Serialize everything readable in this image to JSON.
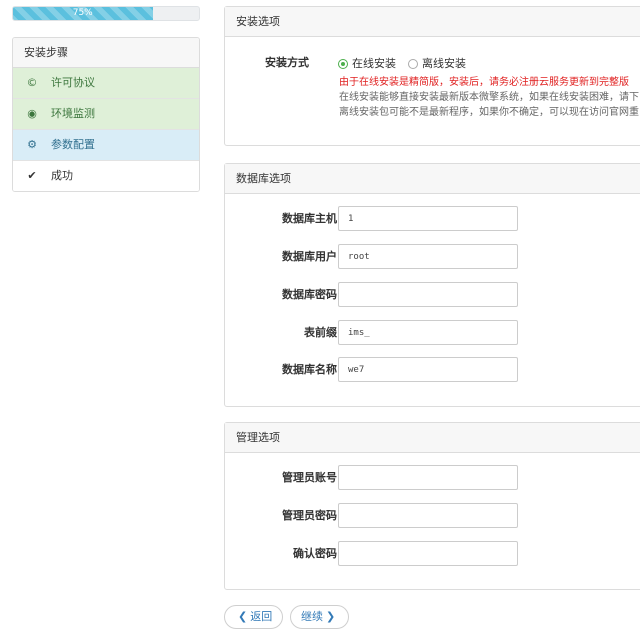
{
  "progress": {
    "value": 0.75,
    "label": "75%"
  },
  "steps": {
    "title": "安装步骤",
    "items": [
      {
        "label": "许可协议",
        "icon": "copyright-icon",
        "glyph": "©",
        "state": "done"
      },
      {
        "label": "环境监测",
        "icon": "eye-icon",
        "glyph": "◉",
        "state": "done"
      },
      {
        "label": "参数配置",
        "icon": "gear-icon",
        "glyph": "⚙",
        "state": "active"
      },
      {
        "label": "成功",
        "icon": "check-icon",
        "glyph": "✔",
        "state": "todo"
      }
    ]
  },
  "install": {
    "title": "安装选项",
    "method_label": "安装方式",
    "online_label": "在线安装",
    "offline_label": "离线安装",
    "selected": "在线安装",
    "note_red": "由于在线安装是精简版，安装后，请务必注册云服务更新到完整版",
    "note_line1": "在线安装能够直接安装最新版本微擎系统，如果在线安装困难，请下",
    "note_line2": "离线安装包可能不是最新程序，如果你不确定，可以现在访问官网重"
  },
  "database": {
    "title": "数据库选项",
    "host_label": "数据库主机",
    "host_value": "1",
    "user_label": "数据库用户",
    "user_value": "root",
    "password_label": "数据库密码",
    "password_value": "",
    "prefix_label": "表前缀",
    "prefix_value": "ims_",
    "name_label": "数据库名称",
    "name_value": "we7"
  },
  "admin": {
    "title": "管理选项",
    "account_label": "管理员账号",
    "password_label": "管理员密码",
    "confirm_label": "确认密码"
  },
  "buttons": {
    "back_label": "返回",
    "next_label": "继续"
  },
  "colors": {
    "done_bg": "#dff0d8",
    "active_bg": "#d9edf7",
    "progress": "#5bc0de",
    "link": "#337ab7",
    "warning": "#e02020"
  }
}
